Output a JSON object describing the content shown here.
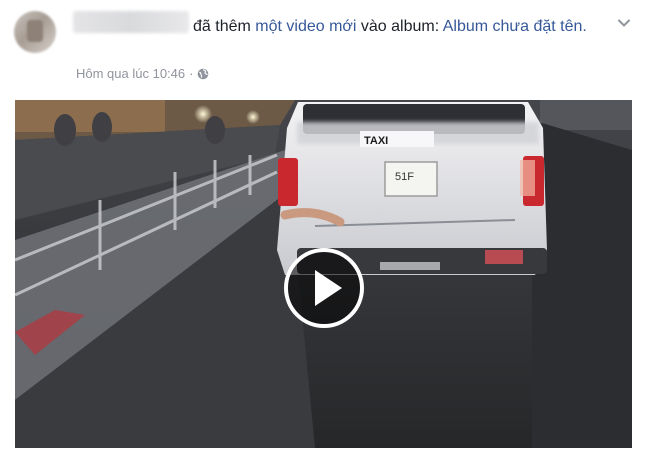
{
  "post": {
    "action_text": "đã thêm",
    "object_link": "một video mới",
    "connector_text": "vào album:",
    "album_link": "Album chưa đặt tên.",
    "timestamp": "Hôm qua lúc 10:46",
    "privacy_icon": "globe-icon",
    "menu_icon": "chevron-down-icon"
  },
  "video": {
    "sign_text": "TAXI",
    "plate_text": "51F",
    "play_icon": "play-icon",
    "colors": {
      "accent": "#365899",
      "meta": "#90949c",
      "text": "#1d2129"
    }
  }
}
